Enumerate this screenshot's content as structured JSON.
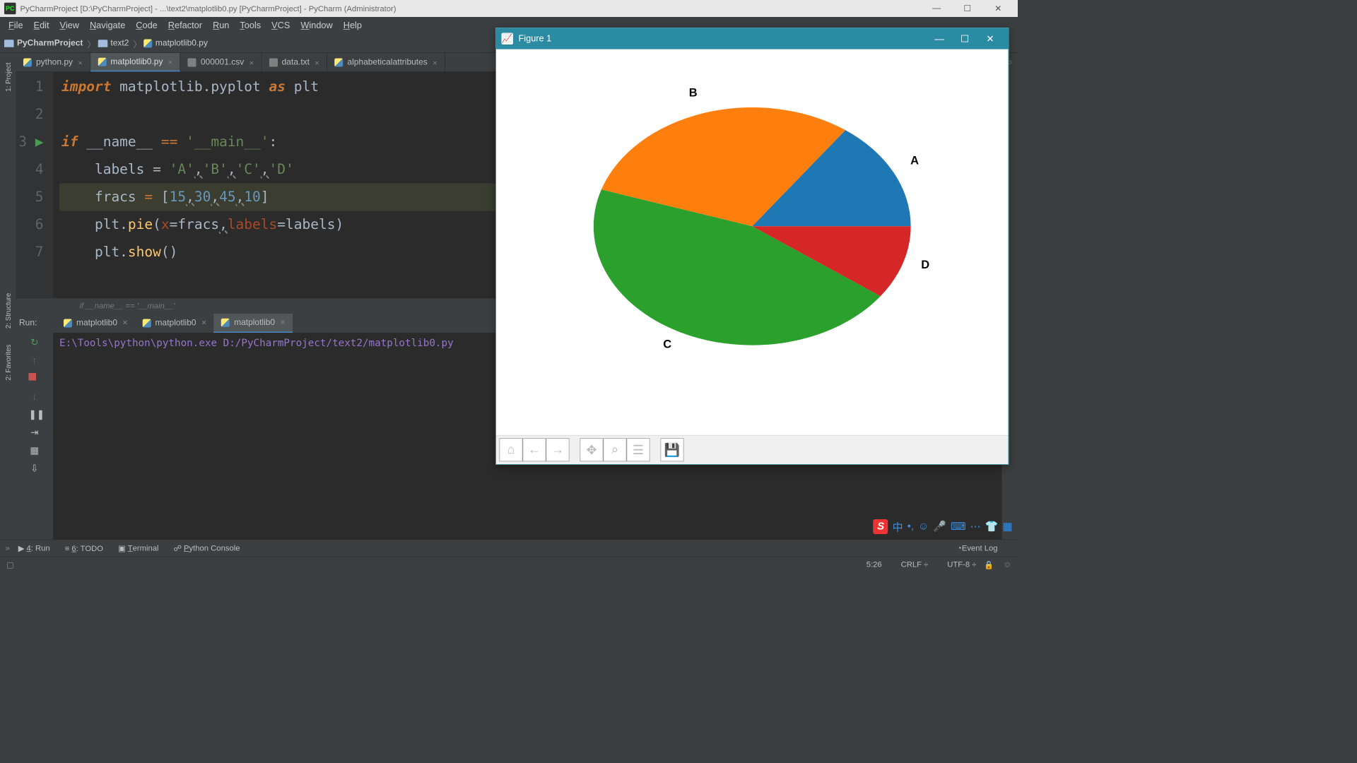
{
  "title": "PyCharmProject [D:\\PyCharmProject] - ...\\text2\\matplotlib0.py [PyCharmProject] - PyCharm (Administrator)",
  "menu": [
    "File",
    "Edit",
    "View",
    "Navigate",
    "Code",
    "Refactor",
    "Run",
    "Tools",
    "VCS",
    "Window",
    "Help"
  ],
  "breadcrumbs": {
    "project": "PyCharmProject",
    "folder": "text2",
    "file": "matplotlib0.py"
  },
  "left_tools": [
    "1: Project",
    "2: Structure",
    "2: Favorites"
  ],
  "tabs": [
    {
      "label": "python.py",
      "kind": "py"
    },
    {
      "label": "matplotlib0.py",
      "kind": "py",
      "active": true
    },
    {
      "label": "000001.csv",
      "kind": "csv"
    },
    {
      "label": "data.txt",
      "kind": "csv"
    },
    {
      "label": "alphabeticalattributes",
      "kind": "py"
    }
  ],
  "code": {
    "lines": [
      {
        "n": 1,
        "html": "<span class='kw'>import</span> matplotlib.pyplot <span class='kw'>as</span> plt"
      },
      {
        "n": 2,
        "html": ""
      },
      {
        "n": 3,
        "html": "<span class='kw'>if</span> __name__ <span class='kw2'>==</span> <span class='str'>'__main__'</span>:",
        "run": true
      },
      {
        "n": 4,
        "html": "    labels = <span class='str'>'A'</span><span class='squig'>,</span><span class='str'>'B'</span><span class='squig'>,</span><span class='str'>'C'</span><span class='squig'>,</span><span class='str'>'D'</span>"
      },
      {
        "n": 5,
        "html": "    fracs <span class='kw2'>=</span> [<span class='num'>15</span><span class='squig'>,</span><span class='num'>30</span><span class='squig'>,</span><span class='num'>45</span><span class='squig'>,</span><span class='num'>10</span>]",
        "hl": true
      },
      {
        "n": 6,
        "html": "    plt.<span class='fn'>pie</span>(<span class='param'>x</span>=fracs<span class='squig'>,</span><span class='param'>labels</span>=labels)"
      },
      {
        "n": 7,
        "html": "    plt.<span class='fn'>show</span>()"
      }
    ],
    "footer": "if __name__ == '__main__'"
  },
  "run": {
    "label": "Run:",
    "tabs": [
      "matplotlib0",
      "matplotlib0",
      "matplotlib0"
    ],
    "active_tab": 2,
    "output": "E:\\Tools\\python\\python.exe D:/PyCharmProject/text2/matplotlib0.py"
  },
  "bottom_tools": [
    {
      "label": "4: Run",
      "pre": "▶"
    },
    {
      "label": "6: TODO",
      "pre": "≡"
    },
    {
      "label": "Terminal",
      "pre": "▣"
    },
    {
      "label": "Python Console",
      "pre": "☍"
    }
  ],
  "event_log": "Event Log",
  "status": {
    "pos": "5:26",
    "crlf": "CRLF",
    "enc": "UTF-8"
  },
  "figure": {
    "title": "Figure 1",
    "toolbar_names": [
      "home-icon",
      "back-icon",
      "forward-icon",
      "pan-icon",
      "zoom-icon",
      "configure-icon",
      "save-icon"
    ]
  },
  "chart_data": {
    "type": "pie",
    "categories": [
      "A",
      "B",
      "C",
      "D"
    ],
    "values": [
      15,
      30,
      45,
      10
    ],
    "colors": [
      "#1f77b4",
      "#ff7f0e",
      "#2ca02c",
      "#d62728"
    ],
    "title": "",
    "labels": [
      "A",
      "B",
      "C",
      "D"
    ]
  }
}
